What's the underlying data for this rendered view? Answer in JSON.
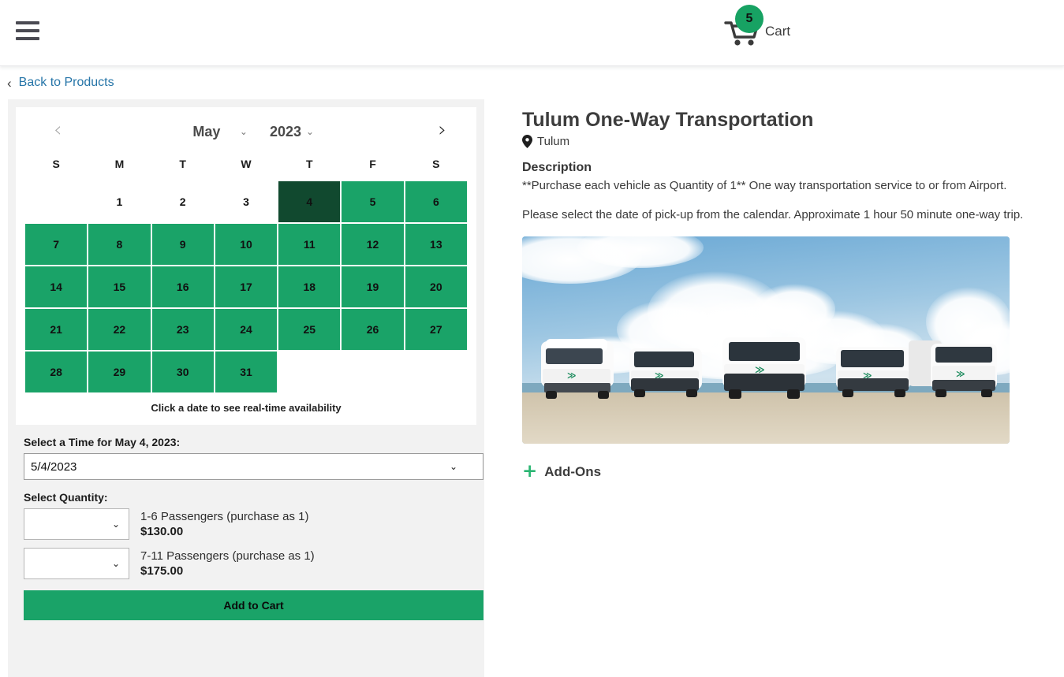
{
  "header": {
    "menu_icon": "hamburger-menu-icon",
    "cart": {
      "label": "Cart",
      "badge_count": "5",
      "icon": "shopping-cart-icon"
    }
  },
  "breadcrumb": {
    "chevron": "‹",
    "back_label": "Back to Products"
  },
  "calendar": {
    "prev_icon": "‹",
    "next_icon": "›",
    "month": "May",
    "year": "2023",
    "caret": "⌄",
    "weekdays": [
      "S",
      "M",
      "T",
      "W",
      "T",
      "F",
      "S"
    ],
    "hint": "Click a date to see real-time availability",
    "weeks": [
      [
        {
          "day": "",
          "state": "empty"
        },
        {
          "day": "1",
          "state": "unavail"
        },
        {
          "day": "2",
          "state": "unavail"
        },
        {
          "day": "3",
          "state": "unavail"
        },
        {
          "day": "4",
          "state": "selected"
        },
        {
          "day": "5",
          "state": "avail"
        },
        {
          "day": "6",
          "state": "avail"
        }
      ],
      [
        {
          "day": "7",
          "state": "avail"
        },
        {
          "day": "8",
          "state": "avail"
        },
        {
          "day": "9",
          "state": "avail"
        },
        {
          "day": "10",
          "state": "avail"
        },
        {
          "day": "11",
          "state": "avail"
        },
        {
          "day": "12",
          "state": "avail"
        },
        {
          "day": "13",
          "state": "avail"
        }
      ],
      [
        {
          "day": "14",
          "state": "avail"
        },
        {
          "day": "15",
          "state": "avail"
        },
        {
          "day": "16",
          "state": "avail"
        },
        {
          "day": "17",
          "state": "avail"
        },
        {
          "day": "18",
          "state": "avail"
        },
        {
          "day": "19",
          "state": "avail"
        },
        {
          "day": "20",
          "state": "avail"
        }
      ],
      [
        {
          "day": "21",
          "state": "avail"
        },
        {
          "day": "22",
          "state": "avail"
        },
        {
          "day": "23",
          "state": "avail"
        },
        {
          "day": "24",
          "state": "avail"
        },
        {
          "day": "25",
          "state": "avail"
        },
        {
          "day": "26",
          "state": "avail"
        },
        {
          "day": "27",
          "state": "avail"
        }
      ],
      [
        {
          "day": "28",
          "state": "avail"
        },
        {
          "day": "29",
          "state": "avail"
        },
        {
          "day": "30",
          "state": "avail"
        },
        {
          "day": "31",
          "state": "avail"
        },
        {
          "day": "",
          "state": "empty"
        },
        {
          "day": "",
          "state": "empty"
        },
        {
          "day": "",
          "state": "empty"
        }
      ]
    ]
  },
  "booking": {
    "time_label": "Select a Time for May 4, 2023:",
    "time_value": "5/4/2023",
    "quantity_label": "Select Quantity:",
    "quantity_options": [
      {
        "value": "",
        "name": "1-6 Passengers (purchase as 1)",
        "price": "$130.00"
      },
      {
        "value": "",
        "name": "7-11 Passengers (purchase as 1)",
        "price": "$175.00"
      }
    ],
    "add_to_cart_label": "Add to Cart"
  },
  "product": {
    "title": "Tulum One-Way Transportation",
    "location": "Tulum",
    "location_icon": "map-pin-icon",
    "description_heading": "Description",
    "description_paragraphs": [
      "**Purchase each vehicle as Quantity of 1** One way transportation service to or from Airport.",
      "Please select the date of pick-up from the calendar. Approximate 1 hour 50 minute one-way trip."
    ],
    "photo_alt": "Five white passenger vans parked on a beach under a blue cloudy sky",
    "addons_label": "Add-Ons",
    "addons_icon": "plus-icon"
  },
  "colors": {
    "available_green": "#1aa368",
    "selected_green": "#11492f",
    "link_blue": "#2675a8",
    "accent_green": "#2bb673"
  }
}
